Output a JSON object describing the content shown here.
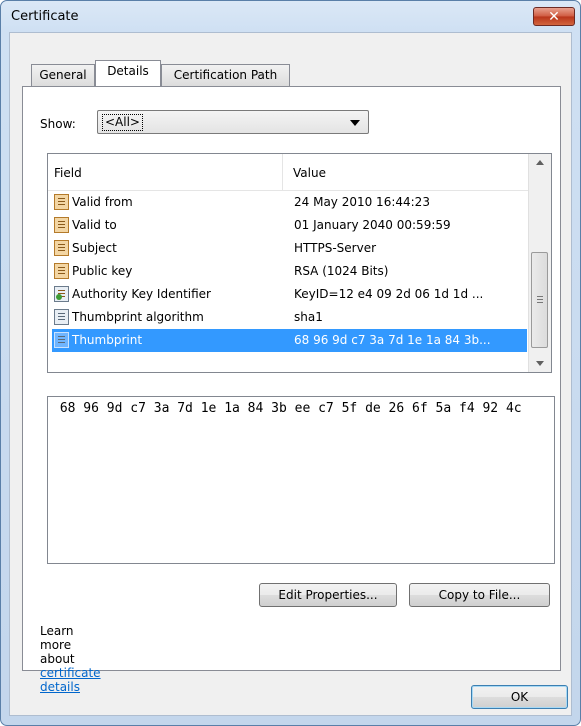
{
  "window": {
    "title": "Certificate",
    "close_glyph": "✕"
  },
  "tabs": [
    {
      "label": "General"
    },
    {
      "label": "Details"
    },
    {
      "label": "Certification Path"
    }
  ],
  "show": {
    "label": "Show:",
    "value": "<All>"
  },
  "list": {
    "headers": {
      "field": "Field",
      "value": "Value"
    },
    "rows": [
      {
        "field": "Valid from",
        "value": "24 May 2010 16:44:23",
        "icon": "certificate-field-icon"
      },
      {
        "field": "Valid to",
        "value": "01 January 2040 00:59:59",
        "icon": "certificate-field-icon"
      },
      {
        "field": "Subject",
        "value": "HTTPS-Server",
        "icon": "certificate-field-icon"
      },
      {
        "field": "Public key",
        "value": "RSA (1024 Bits)",
        "icon": "certificate-field-icon"
      },
      {
        "field": "Authority Key Identifier",
        "value": "KeyID=12 e4 09 2d 06 1d 1d ...",
        "icon": "extension-key-icon"
      },
      {
        "field": "Thumbprint algorithm",
        "value": "sha1",
        "icon": "property-icon"
      },
      {
        "field": "Thumbprint",
        "value": "68 96 9d c7 3a 7d 1e 1a 84 3b...",
        "icon": "property-icon",
        "selected": true
      }
    ]
  },
  "detail": {
    "text": " 68 96 9d c7 3a 7d 1e 1a 84 3b ee c7 5f de 26 6f 5a f4 92 4c"
  },
  "buttons": {
    "edit_properties": "Edit Properties...",
    "copy_to_file": "Copy to File...",
    "ok": "OK"
  },
  "learn_more": {
    "prefix": "Learn more about ",
    "link": "certificate details"
  },
  "colors": {
    "selection": "#3399ff",
    "link": "#0066cc",
    "close_button": "#c9472c"
  }
}
